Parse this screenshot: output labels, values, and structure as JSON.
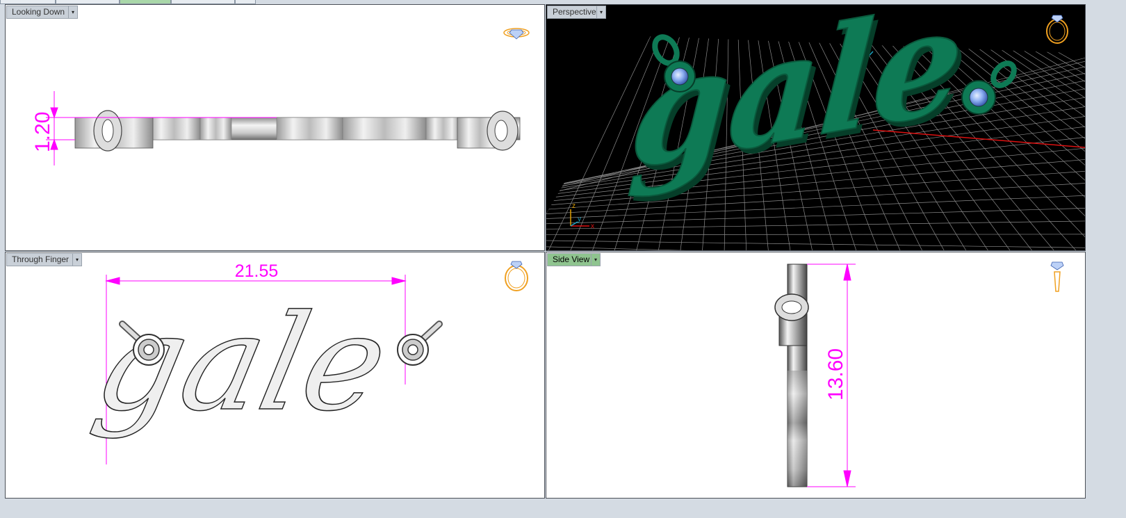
{
  "viewports": {
    "top_left": {
      "label": "Looking Down",
      "dimension": "1.20"
    },
    "top_right": {
      "label": "Perspective",
      "model_text": "gale",
      "axis_labels": {
        "z": "z",
        "y": "y",
        "x": "x"
      }
    },
    "bottom_left": {
      "label": "Through Finger",
      "dimension": "21.55",
      "model_text": "gale"
    },
    "bottom_right": {
      "label": "Side View",
      "dimension": "13.60"
    }
  },
  "dropdown_glyph": "▾",
  "colors": {
    "dimension": "#ff00ff",
    "model_green": "#0e7a55",
    "gem_blue": "#8fb1f2",
    "active_label": "#8fc48f",
    "icon_orange": "#f0a020"
  }
}
